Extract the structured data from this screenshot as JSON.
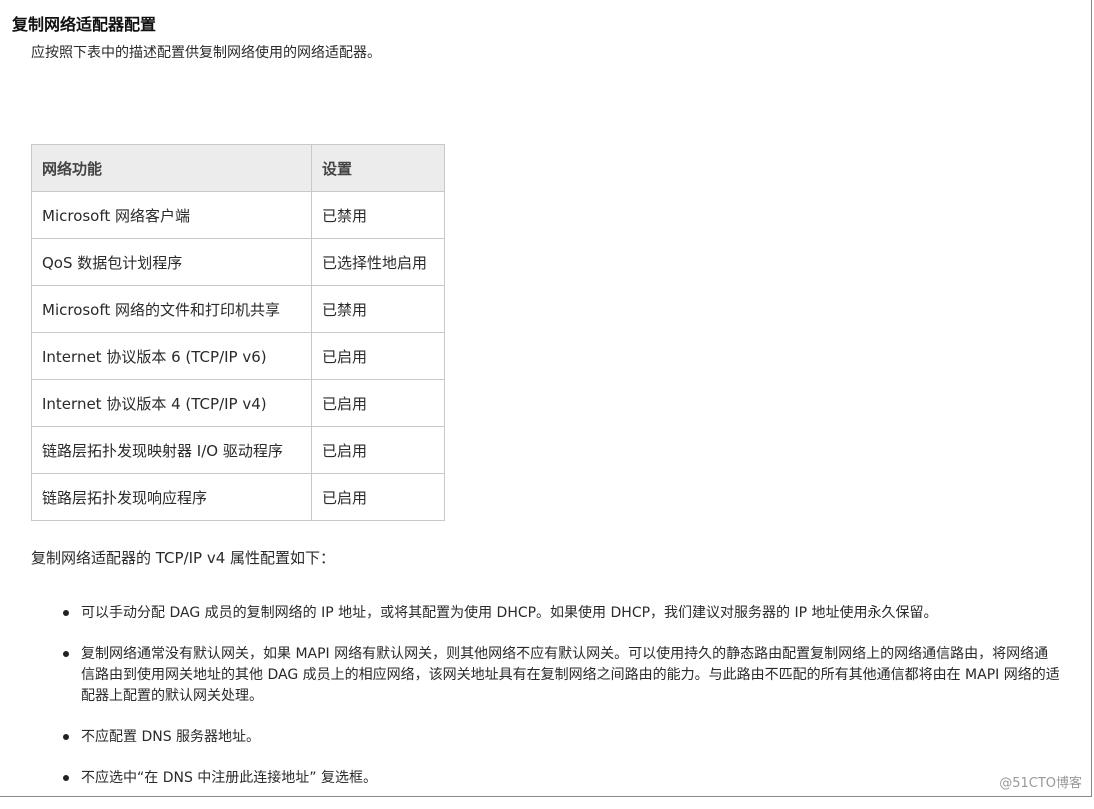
{
  "section": {
    "title": "复制网络适配器配置",
    "intro": "应按照下表中的描述配置供复制网络使用的网络适配器。"
  },
  "table": {
    "headers": [
      "网络功能",
      "设置"
    ],
    "rows": [
      [
        "Microsoft 网络客户端",
        "已禁用"
      ],
      [
        "QoS 数据包计划程序",
        "已选择性地启用"
      ],
      [
        "Microsoft 网络的文件和打印机共享",
        "已禁用"
      ],
      [
        "Internet 协议版本 6 (TCP/IP v6)",
        "已启用"
      ],
      [
        "Internet 协议版本 4 (TCP/IP v4)",
        "已启用"
      ],
      [
        "链路层拓扑发现映射器 I/O 驱动程序",
        "已启用"
      ],
      [
        "链路层拓扑发现响应程序",
        "已启用"
      ]
    ]
  },
  "tcpip": {
    "intro": "复制网络适配器的 TCP/IP v4 属性配置如下：",
    "items": [
      "可以手动分配 DAG 成员的复制网络的 IP 地址，或将其配置为使用 DHCP。如果使用 DHCP，我们建议对服务器的 IP 地址使用永久保留。",
      "复制网络通常没有默认网关，如果 MAPI 网络有默认网关，则其他网络不应有默认网关。可以使用持久的静态路由配置复制网络上的网络通信路由，将网络通信路由到使用网关地址的其他 DAG 成员上的相应网络，该网关地址具有在复制网络之间路由的能力。与此路由不匹配的所有其他通信都将由在 MAPI 网络的适配器上配置的默认网关处理。",
      "不应配置 DNS 服务器地址。",
      "不应选中“在 DNS 中注册此连接地址” 复选框。"
    ]
  },
  "watermark": "@51CTO博客"
}
